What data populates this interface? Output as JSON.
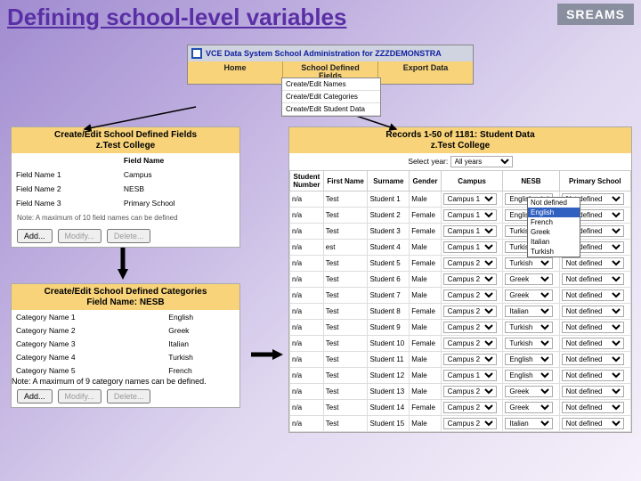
{
  "title": "Defining school-level variables",
  "logo": "SREAMS",
  "top": {
    "bar": "VCE Data System School Administration for ZZZDEMONSTRA",
    "menu": [
      "Home",
      "School Defined\nFields",
      "Export Data"
    ],
    "drop": [
      "Create/Edit Names",
      "Create/Edit Categories",
      "Create/Edit Student Data"
    ]
  },
  "fieldsPanel": {
    "hdr": "Create/Edit School Defined Fields\nz.Test College",
    "colhdr": "Field Name",
    "rows": [
      [
        "Field Name 1",
        "Campus"
      ],
      [
        "Field Name 2",
        "NESB"
      ],
      [
        "Field Name 3",
        "Primary School"
      ]
    ],
    "note": "Note: A maximum of 10 field names can be defined",
    "btns": [
      "Add...",
      "Modify...",
      "Delete..."
    ]
  },
  "catsPanel": {
    "hdr": "Create/Edit School Defined Categories\nField Name: NESB",
    "rows": [
      [
        "Category Name 1",
        "English"
      ],
      [
        "Category Name 2",
        "Greek"
      ],
      [
        "Category Name 3",
        "Italian"
      ],
      [
        "Category Name 4",
        "Turkish"
      ],
      [
        "Category Name 5",
        "French"
      ]
    ],
    "note": "Note: A maximum of 9 category names can be defined.",
    "btns": [
      "Add...",
      "Modify...",
      "Delete..."
    ]
  },
  "records": {
    "hdr": "Records 1-50 of 1181: Student Data\nz.Test College",
    "yrlbl": "Select year:",
    "yrval": "All years",
    "cols": [
      "Student\nNumber",
      "First Name",
      "Surname",
      "Gender",
      "Campus",
      "NESB",
      "Primary School"
    ],
    "rows": [
      [
        "n/a",
        "Test",
        "Student 1",
        "Male",
        "Campus 1",
        "English",
        "Not defined"
      ],
      [
        "n/a",
        "Test",
        "Student 2",
        "Female",
        "Campus 1",
        "English",
        "Not defined"
      ],
      [
        "n/a",
        "Test",
        "Student 3",
        "Female",
        "Campus 1",
        "Turkish",
        "Not defined"
      ],
      [
        "n/a",
        "est",
        "Student 4",
        "Male",
        "Campus 1",
        "Turkish",
        "Not defined"
      ],
      [
        "n/a",
        "Test",
        "Student 5",
        "Female",
        "Campus 2",
        "Turkish",
        "Not defined"
      ],
      [
        "n/a",
        "Test",
        "Student 6",
        "Male",
        "Campus 2",
        "Greek",
        "Not defined"
      ],
      [
        "n/a",
        "Test",
        "Student 7",
        "Male",
        "Campus 2",
        "Greek",
        "Not defined"
      ],
      [
        "n/a",
        "Test",
        "Student 8",
        "Female",
        "Campus 2",
        "Italian",
        "Not defined"
      ],
      [
        "n/a",
        "Test",
        "Student 9",
        "Male",
        "Campus 2",
        "Turkish",
        "Not defined"
      ],
      [
        "n/a",
        "Test",
        "Student 10",
        "Female",
        "Campus 2",
        "Turkish",
        "Not defined"
      ],
      [
        "n/a",
        "Test",
        "Student 11",
        "Male",
        "Campus 2",
        "English",
        "Not defined"
      ],
      [
        "n/a",
        "Test",
        "Student 12",
        "Male",
        "Campus 1",
        "English",
        "Not defined"
      ],
      [
        "n/a",
        "Test",
        "Student 13",
        "Male",
        "Campus 2",
        "Greek",
        "Not defined"
      ],
      [
        "n/a",
        "Test",
        "Student 14",
        "Female",
        "Campus 2",
        "Greek",
        "Not defined"
      ],
      [
        "n/a",
        "Test",
        "Student 15",
        "Male",
        "Campus 2",
        "Italian",
        "Not defined"
      ]
    ]
  },
  "dropdown": [
    "Not defined",
    "English",
    "French",
    "Greek",
    "Italian",
    "Turkish"
  ],
  "dropdownHi": 1
}
